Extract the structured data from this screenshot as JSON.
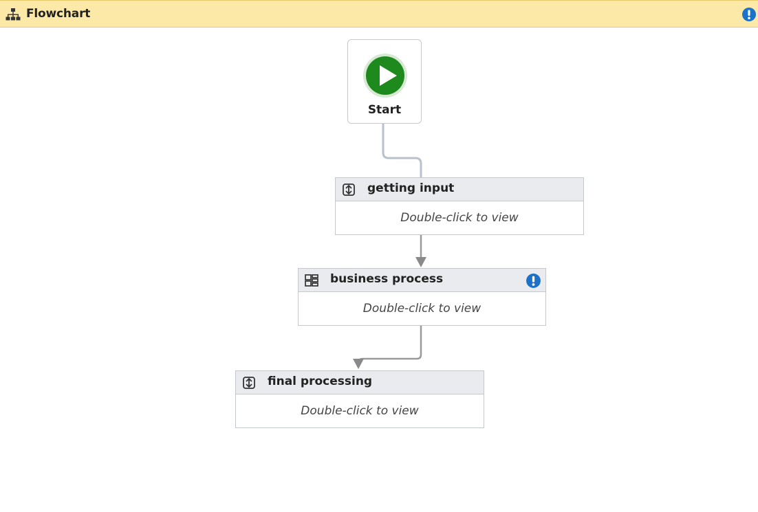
{
  "header": {
    "title": "Flowchart",
    "icon": "flowchart-icon",
    "warning_icon": "warning-info-icon",
    "background": "#fce9a8"
  },
  "start": {
    "label": "Start",
    "icon": "play-icon",
    "color": "#1e8a1e"
  },
  "activities": [
    {
      "title": "getting input",
      "body": "Double-click to view",
      "icon": "invoke-workflow-icon",
      "warning": false
    },
    {
      "title": "business process",
      "body": "Double-click to view",
      "icon": "sequence-icon",
      "warning": true
    },
    {
      "title": "final processing",
      "body": "Double-click to view",
      "icon": "invoke-workflow-icon",
      "warning": false
    }
  ],
  "colors": {
    "warning": "#1a73c8",
    "connector": "#9a9a9a"
  }
}
